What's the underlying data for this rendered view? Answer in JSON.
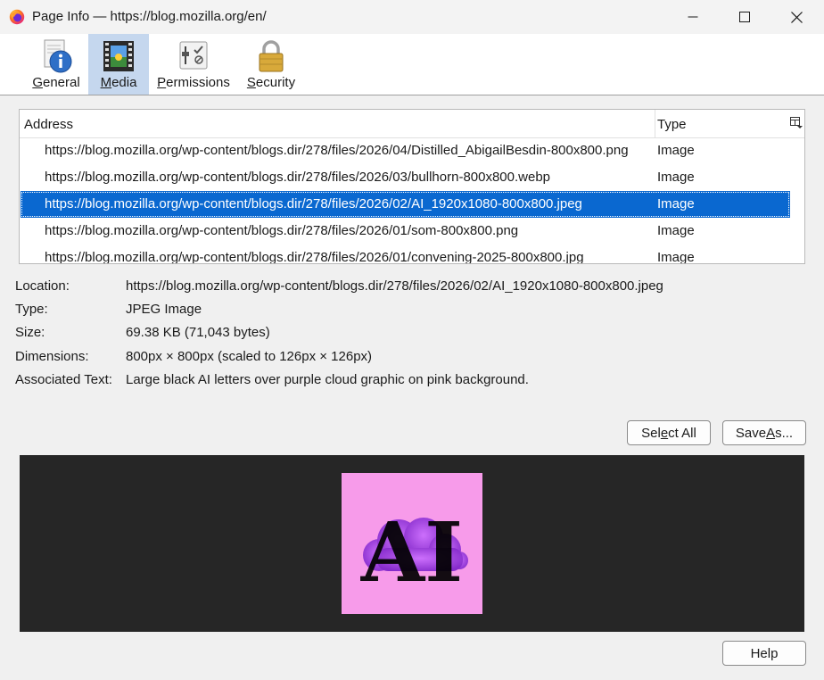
{
  "window": {
    "title": "Page Info — https://blog.mozilla.org/en/",
    "app_icon": "firefox-icon",
    "controls": [
      "minimize-icon",
      "maximize-icon",
      "close-icon"
    ]
  },
  "tabs": [
    {
      "label_pre": "",
      "accesskey": "G",
      "label_post": "eneral",
      "icon": "info-icon",
      "active": false
    },
    {
      "label_pre": "",
      "accesskey": "M",
      "label_post": "edia",
      "icon": "media-icon",
      "active": true
    },
    {
      "label_pre": "",
      "accesskey": "P",
      "label_post": "ermissions",
      "icon": "permissions-icon",
      "active": false
    },
    {
      "label_pre": "",
      "accesskey": "S",
      "label_post": "ecurity",
      "icon": "lock-icon",
      "active": false
    }
  ],
  "media_list": {
    "columns": {
      "address": "Address",
      "type": "Type"
    },
    "rows": [
      {
        "address": "https://blog.mozilla.org/wp-content/blogs.dir/278/files/2026/04/Distilled_AbigailBesdin-800x800.png",
        "type": "Image",
        "selected": false
      },
      {
        "address": "https://blog.mozilla.org/wp-content/blogs.dir/278/files/2026/03/bullhorn-800x800.webp",
        "type": "Image",
        "selected": false
      },
      {
        "address": "https://blog.mozilla.org/wp-content/blogs.dir/278/files/2026/02/AI_1920x1080-800x800.jpeg",
        "type": "Image",
        "selected": true
      },
      {
        "address": "https://blog.mozilla.org/wp-content/blogs.dir/278/files/2026/01/som-800x800.png",
        "type": "Image",
        "selected": false
      },
      {
        "address": "https://blog.mozilla.org/wp-content/blogs.dir/278/files/2026/01/convening-2025-800x800.jpg",
        "type": "Image",
        "selected": false
      }
    ]
  },
  "details": {
    "location_label": "Location:",
    "location_value": "https://blog.mozilla.org/wp-content/blogs.dir/278/files/2026/02/AI_1920x1080-800x800.jpeg",
    "type_label": "Type:",
    "type_value": "JPEG Image",
    "size_label": "Size:",
    "size_value": "69.38 KB (71,043 bytes)",
    "dimensions_label": "Dimensions:",
    "dimensions_value": "800px × 800px (scaled to 126px × 126px)",
    "assoc_label": "Associated Text:",
    "assoc_value": "Large black AI letters over purple cloud graphic on pink background."
  },
  "buttons": {
    "select_all": {
      "pre": "Sel",
      "key": "e",
      "post": "ct All"
    },
    "save_as": {
      "pre": "Save ",
      "key": "A",
      "post": "s..."
    },
    "help": "Help"
  },
  "preview": {
    "image_text": "AI",
    "background_color": "#f79bea",
    "text_color": "#000000",
    "cloud_color": "#8a2be2"
  },
  "colors": {
    "selection": "#0a68d0",
    "active_tab": "#c5d7ee",
    "preview_bg": "#262626"
  }
}
